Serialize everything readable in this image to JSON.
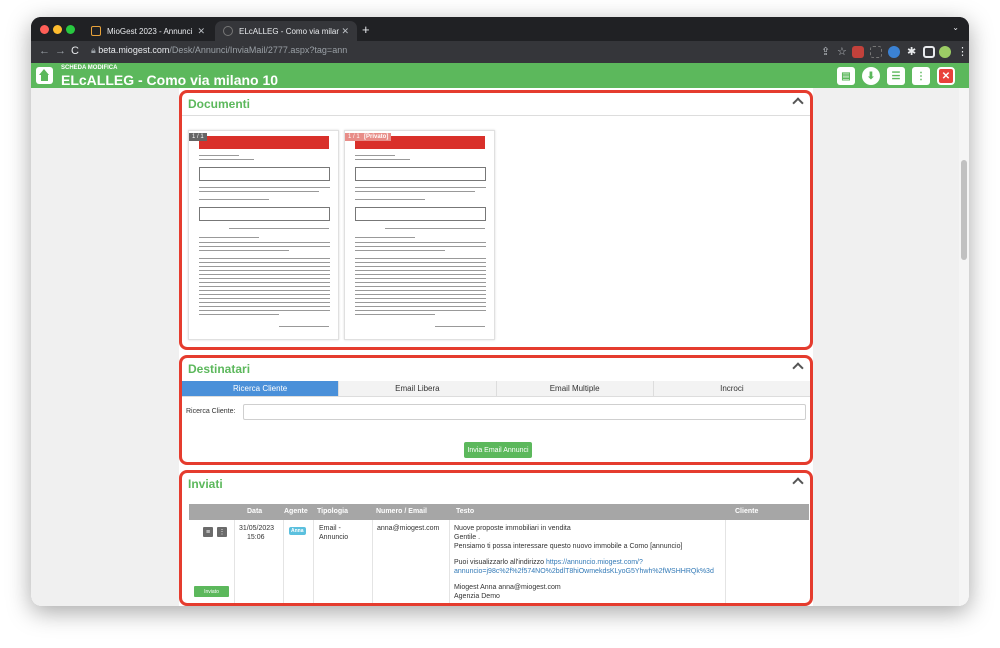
{
  "browser": {
    "tabs": [
      {
        "title": "MioGest 2023 - Annunci",
        "active": false
      },
      {
        "title": "ELcALLEG - Como via milano 10",
        "active": true
      }
    ],
    "url_host": "beta.miogest.com",
    "url_path": "/Desk/Annunci/InviaMail/2777.aspx?tag=ann"
  },
  "header": {
    "subtitle": "SCHEDA MODIFICA",
    "title": "ELcALLEG - Como via milano 10"
  },
  "documenti": {
    "title": "Documenti",
    "pages": [
      {
        "number": "1 / 1",
        "badge": ""
      },
      {
        "number": "1 / 1",
        "badge": "[Privato]"
      }
    ]
  },
  "destinatari": {
    "title": "Destinatari",
    "tabs": [
      "Ricerca Cliente",
      "Email Libera",
      "Email Multiple",
      "Incroci"
    ],
    "selected_tab": "Ricerca Cliente",
    "search_label": "Ricerca Cliente:",
    "search_value": "",
    "send_button": "Invia Email Annunci"
  },
  "inviati": {
    "title": "Inviati",
    "columns": [
      "Data",
      "Agente",
      "Tipologia",
      "Numero / Email",
      "Testo",
      "Cliente"
    ],
    "rows": [
      {
        "date": "31/05/2023",
        "time": "15:06",
        "agent": "Anna",
        "type_line1": "Email -",
        "type_line2": "Annuncio",
        "email": "anna@miogest.com",
        "text_line1": "Nuove proposte immobiliari in vendita",
        "text_line2": "Gentile .",
        "text_line3": "Pensiamo ti possa interessare questo nuovo immobile a Como [annuncio]",
        "text_line4": "Puoi visualizzarlo all'indirizzo",
        "link1": "https://annuncio.miogest.com/?",
        "link2": "annuncio=j98c%2f%2f574NO%2bdlT8hiOwmekdsKLyoG5Yhwh%2fWSHHRQk%3d",
        "signature": "Miogest Anna anna@miogest.com",
        "agency": "Agenzia Demo",
        "client": "",
        "status": "Inviato"
      }
    ]
  },
  "colors": {
    "brand_green": "#5cb85c",
    "highlight_red": "#e53c2e",
    "tab_blue": "#4a90d9"
  }
}
